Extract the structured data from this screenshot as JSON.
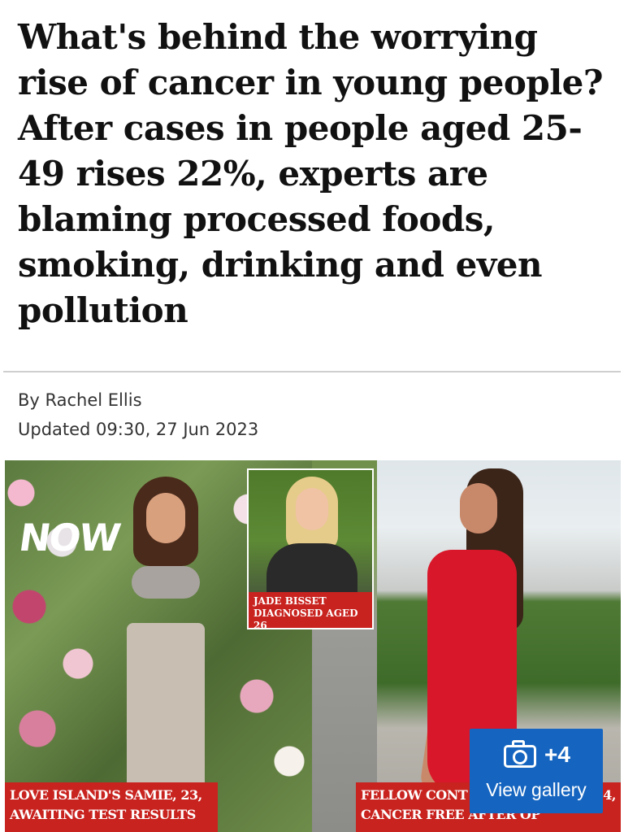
{
  "article": {
    "headline": "What's behind the worrying rise of cancer in young people? After cases in people aged 25-49 rises 22%, experts are blaming processed foods, smoking, drinking and even pollution",
    "byline": "By Rachel Ellis",
    "updated": "Updated 09:30, 27 Jun 2023"
  },
  "photo": {
    "logo_text": "NOW",
    "inset_caption_line1": "JADE BISSET",
    "inset_caption_line2": "DIAGNOSED AGED 26",
    "caption_left_line1": "LOVE ISLAND'S SAMIE, 23,",
    "caption_left_line2": "AWAITING TEST RESULTS",
    "caption_right_line1": "FELLOW CONT",
    "caption_right_line1_end": "4,",
    "caption_right_line2": "CANCER FREE AFTER OP",
    "caption_color": "#c8231f"
  },
  "gallery": {
    "icon": "camera-icon",
    "count": "+4",
    "label": "View gallery",
    "color": "#1565c0"
  }
}
